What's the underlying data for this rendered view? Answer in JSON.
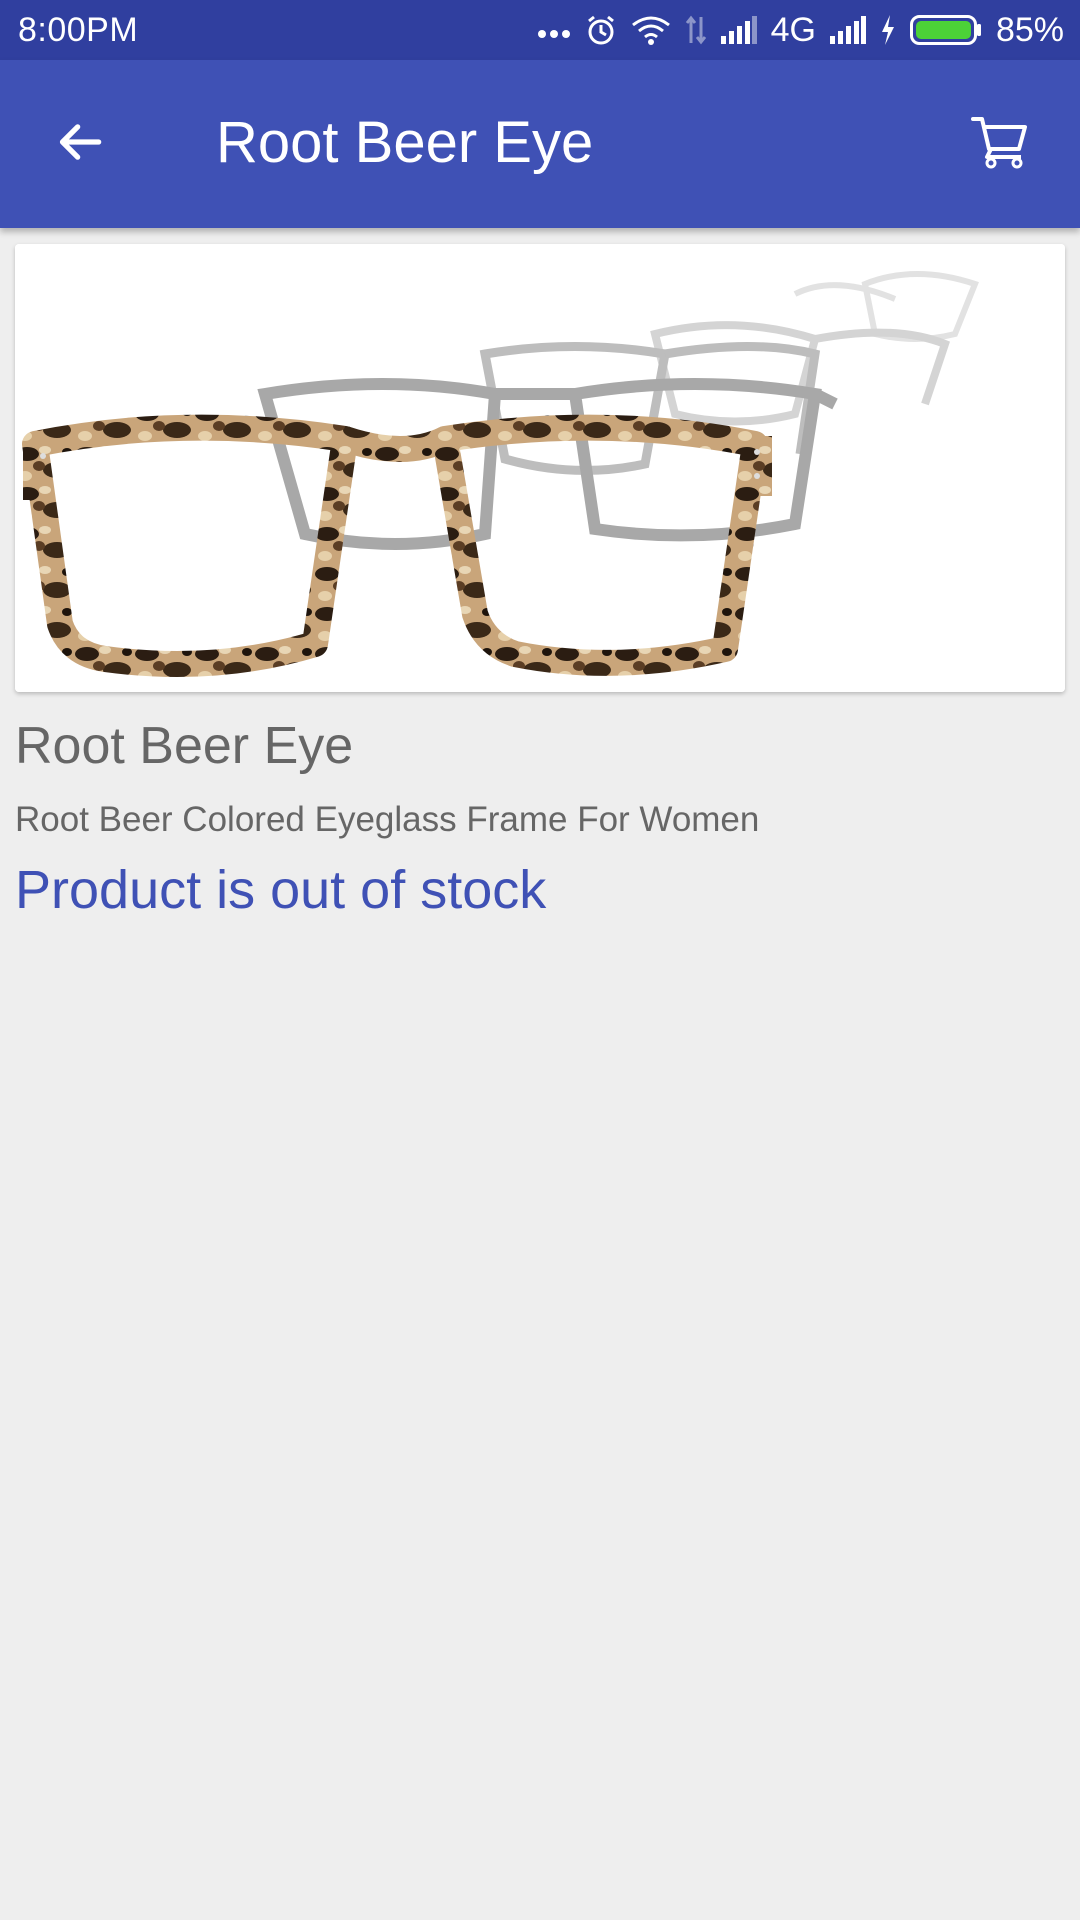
{
  "status_bar": {
    "time": "8:00PM",
    "network": "4G",
    "battery": "85%",
    "icons": [
      "more-dots-icon",
      "alarm-icon",
      "wifi-icon",
      "data-arrows-icon",
      "signal-icon",
      "signal-icon",
      "charging-icon",
      "battery-icon"
    ]
  },
  "app_bar": {
    "title": "Root Beer Eye",
    "back_icon": "arrow-back-icon",
    "cart_icon": "shopping-cart-icon",
    "color": "#3f51b5"
  },
  "product": {
    "image": "eyeglasses-photo",
    "name": "Root Beer Eye",
    "description": "Root Beer Colored Eyeglass Frame For Women",
    "stock_status": "Product is out of stock",
    "stock_color": "#3f51b5"
  }
}
